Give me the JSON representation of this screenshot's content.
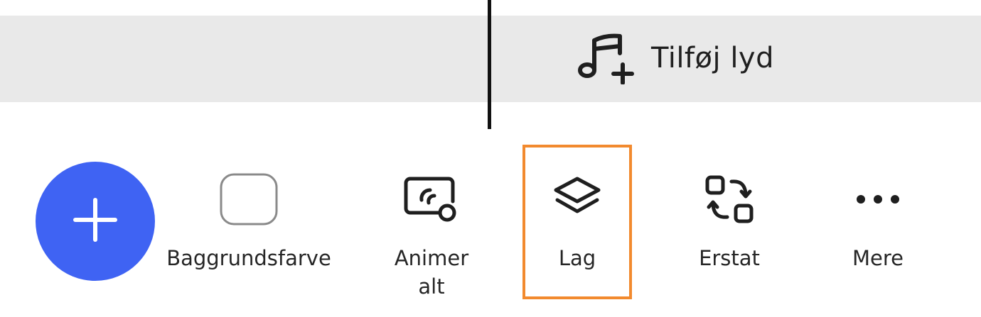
{
  "timeline": {
    "add_audio_label": "Tilføj lyd",
    "add_audio_icon": "music-plus-icon"
  },
  "fab": {
    "icon": "plus-icon",
    "color": "#3f63f3"
  },
  "toolbar": {
    "items": [
      {
        "label": "Baggrundsfarve",
        "icon": "rounded-square-icon"
      },
      {
        "label": "Animer alt",
        "icon": "animate-all-icon"
      },
      {
        "label": "Lag",
        "icon": "layers-icon",
        "highlighted": true
      },
      {
        "label": "Erstat",
        "icon": "replace-icon"
      },
      {
        "label": "Mere",
        "icon": "more-dots-icon"
      }
    ]
  },
  "highlight_color": "#f28a2e"
}
